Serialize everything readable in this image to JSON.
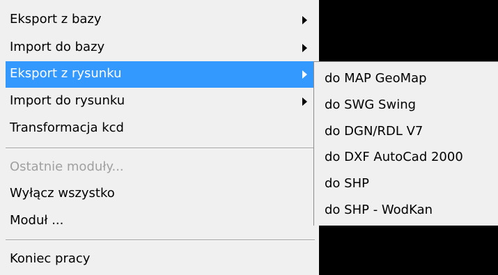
{
  "main_menu": {
    "items": [
      {
        "label": "Eksport z bazy",
        "has_submenu": true
      },
      {
        "label": "Import do bazy",
        "has_submenu": true
      },
      {
        "label": "Eksport z rysunku",
        "has_submenu": true,
        "highlighted": true
      },
      {
        "label": "Import do rysunku",
        "has_submenu": true
      },
      {
        "label": "Transformacja kcd",
        "has_submenu": false
      },
      {
        "label": "Ostatnie moduły...",
        "disabled": true
      },
      {
        "label": "Wyłącz wszystko"
      },
      {
        "label": "Moduł ..."
      },
      {
        "label": "Koniec pracy"
      }
    ]
  },
  "submenu": {
    "items": [
      {
        "label": "do MAP GeoMap"
      },
      {
        "label": "do SWG Swing"
      },
      {
        "label": "do DGN/RDL V7"
      },
      {
        "label": "do DXF AutoCad 2000"
      },
      {
        "label": "do SHP"
      },
      {
        "label": "do SHP - WodKan"
      }
    ]
  },
  "colors": {
    "menu_background": "#f0f0f0",
    "highlight": "#3399ff",
    "disabled_text": "#a0a0a0",
    "outside_background": "#000000"
  },
  "icons": {
    "submenu_arrow": "chevron-right-icon"
  }
}
